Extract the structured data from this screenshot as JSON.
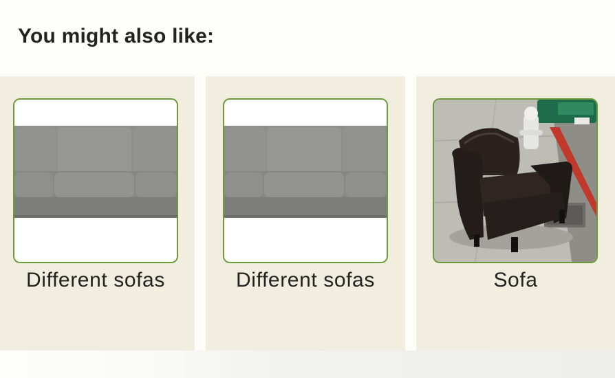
{
  "section": {
    "title": "You might also like:"
  },
  "items": [
    {
      "caption": "Different sofas",
      "image_icon": "gray-sofa-image"
    },
    {
      "caption": "Different sofas",
      "image_icon": "gray-sofa-image"
    },
    {
      "caption": "Sofa",
      "image_icon": "leather-armchair-image"
    }
  ],
  "colors": {
    "card_background": "#f1eee0",
    "thumbnail_border": "#6a9a3a",
    "text": "#222222"
  }
}
